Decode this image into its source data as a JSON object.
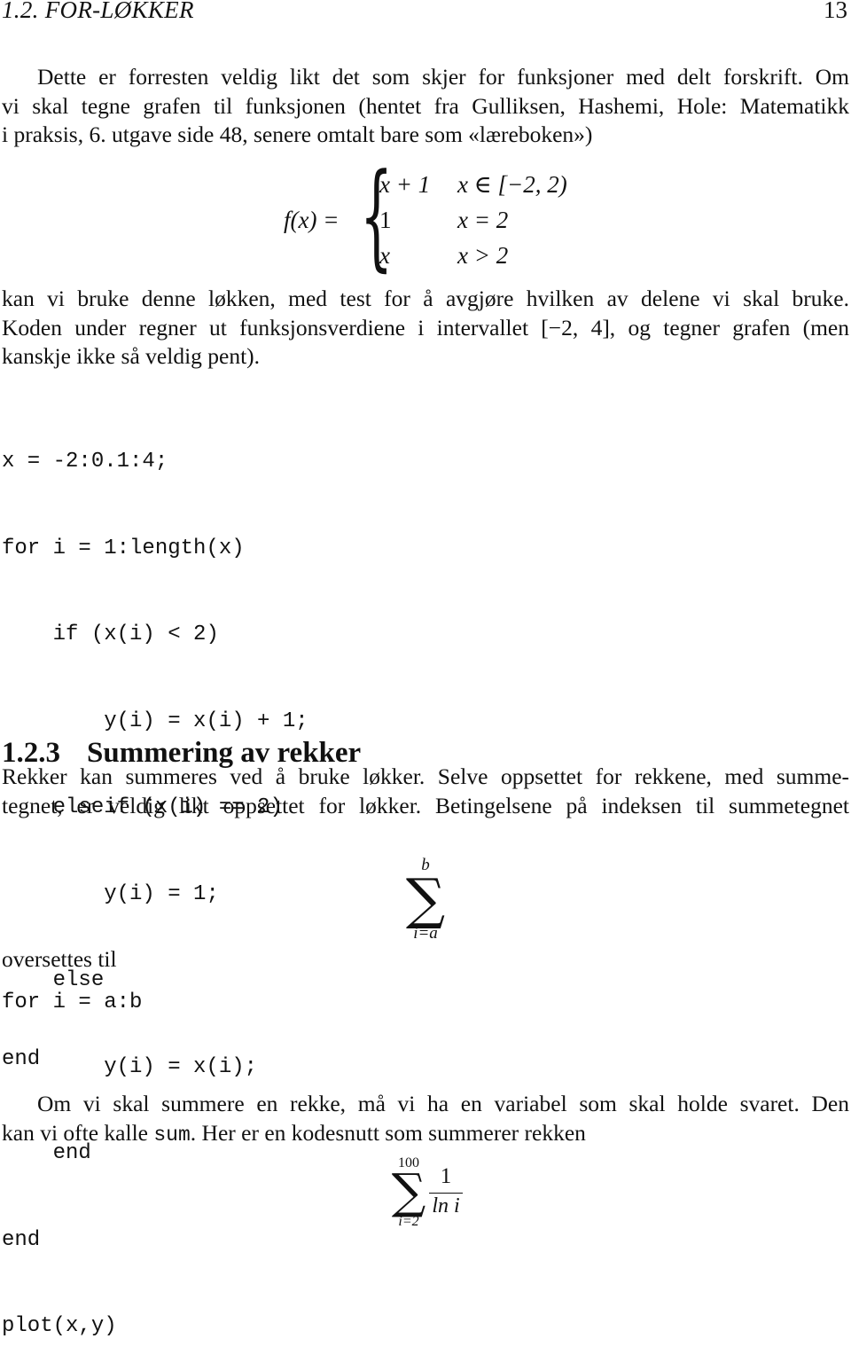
{
  "header": {
    "section": "1.2.  FOR-LØKKER",
    "page_number": "13"
  },
  "intro_paragraph": {
    "lines": [
      "Dette er forresten veldig likt det som skjer for funksjoner med delt forskrift. Om",
      "vi skal tegne grafen til funksjonen (hentet fra Gulliksen, Hashemi, Hole: Matematikk",
      "i praksis, 6. utgave side 48, senere omtalt bare som «læreboken»)"
    ]
  },
  "piecewise": {
    "lhs": "f(x) =",
    "cases": [
      {
        "expr": "x + 1",
        "cond": "x ∈ [−2, 2)"
      },
      {
        "expr": "1",
        "cond": "x = 2"
      },
      {
        "expr": "x",
        "cond": "x > 2"
      }
    ]
  },
  "after_formula_paragraph": {
    "lines": [
      "kan vi bruke denne løkken, med test for å avgjøre hvilken av delene vi skal bruke.",
      "Koden under regner ut funksjonsverdiene i intervallet [−2, 4], og tegner grafen (men",
      "kanskje ikke så veldig pent)."
    ]
  },
  "code_block_1": {
    "lines": [
      "x = -2:0.1:4;",
      "for i = 1:length(x)",
      "    if (x(i) < 2)",
      "        y(i) = x(i) + 1;",
      "    elseif (x(i) == 2)",
      "        y(i) = 1;",
      "    else",
      "        y(i) = x(i);",
      "    end",
      "end",
      "plot(x,y)"
    ]
  },
  "section_heading": {
    "number": "1.2.3",
    "title": "Summering av rekker"
  },
  "summation_paragraph": {
    "lines": [
      "Rekker kan summeres ved å bruke løkker. Selve oppsettet for rekkene, med summe-",
      "tegnet, er veldig likt oppsettet for løkker. Betingelsene på indeksen til summetegnet"
    ]
  },
  "sum_formula_1": {
    "upper": "b",
    "lower": "i=a",
    "symbol": "∑"
  },
  "translates_to": "oversettes til",
  "code_block_2": {
    "lines": [
      "for i = a:b",
      "",
      "end"
    ]
  },
  "final_paragraph": {
    "line1": "Om vi skal summere en rekke, må vi ha en variabel som skal holde svaret. Den",
    "line2_before": "kan vi ofte kalle ",
    "line2_code": "sum",
    "line2_after": ". Her er en kodesnutt som summerer rekken"
  },
  "sum_formula_2": {
    "upper": "100",
    "lower": "i=2",
    "symbol": "∑",
    "numerator": "1",
    "denominator": "ln i"
  }
}
